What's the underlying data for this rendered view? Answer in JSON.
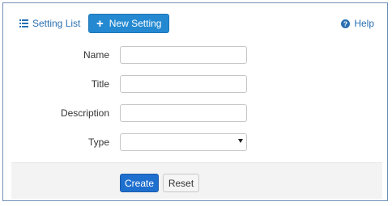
{
  "toolbar": {
    "list_label": "Setting List",
    "new_label": "New Setting",
    "help_label": "Help",
    "list_icon": "list-icon",
    "new_icon": "plus-icon",
    "help_icon": "question-circle-icon"
  },
  "form": {
    "fields": [
      {
        "label": "Name",
        "value": ""
      },
      {
        "label": "Title",
        "value": ""
      },
      {
        "label": "Description",
        "value": ""
      },
      {
        "label": "Type",
        "value": ""
      }
    ],
    "create_label": "Create",
    "reset_label": "Reset"
  },
  "colors": {
    "primary": "#2489d1",
    "create_button": "#1f6fce",
    "link": "#2a6fb0",
    "footer_bg": "#f3f3f3",
    "frame_border": "#6f8fb8"
  }
}
